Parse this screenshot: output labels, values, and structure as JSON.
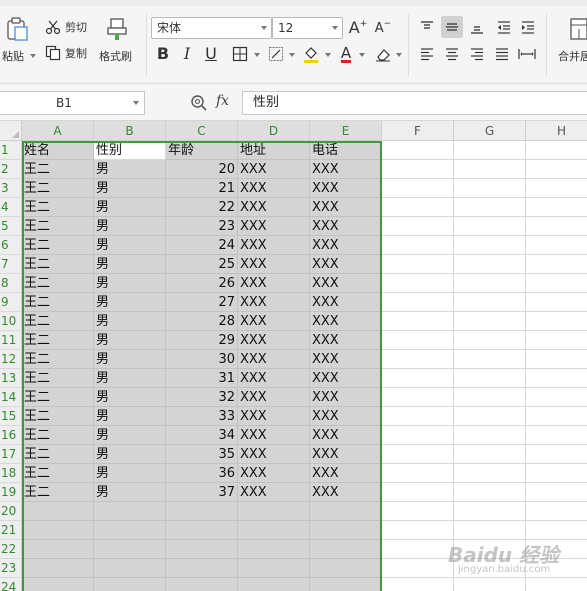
{
  "ribbon": {
    "paste_label": "粘贴",
    "cut_label": "剪切",
    "copy_label": "复制",
    "format_painter_label": "格式刷",
    "font_name": "宋体",
    "font_size": "12",
    "bold": "B",
    "italic": "I",
    "underline": "U",
    "grow_font": "A",
    "shrink_font": "A",
    "font_color": "A",
    "merge_label": "合并居"
  },
  "formula_bar": {
    "name_box": "B1",
    "fx_label": "fx",
    "content": "性别"
  },
  "columns": [
    "A",
    "B",
    "C",
    "D",
    "E",
    "F",
    "G",
    "H"
  ],
  "selected_columns": [
    "A",
    "B",
    "C",
    "D",
    "E"
  ],
  "rows": [
    [
      "姓名",
      "性别",
      "年龄",
      "地址",
      "电话"
    ],
    [
      "王二",
      "男",
      "20",
      "XXX",
      "XXX"
    ],
    [
      "王二",
      "男",
      "21",
      "XXX",
      "XXX"
    ],
    [
      "王二",
      "男",
      "22",
      "XXX",
      "XXX"
    ],
    [
      "王二",
      "男",
      "23",
      "XXX",
      "XXX"
    ],
    [
      "王二",
      "男",
      "24",
      "XXX",
      "XXX"
    ],
    [
      "王二",
      "男",
      "25",
      "XXX",
      "XXX"
    ],
    [
      "王二",
      "男",
      "26",
      "XXX",
      "XXX"
    ],
    [
      "王二",
      "男",
      "27",
      "XXX",
      "XXX"
    ],
    [
      "王二",
      "男",
      "28",
      "XXX",
      "XXX"
    ],
    [
      "王二",
      "男",
      "29",
      "XXX",
      "XXX"
    ],
    [
      "王二",
      "男",
      "30",
      "XXX",
      "XXX"
    ],
    [
      "王二",
      "男",
      "31",
      "XXX",
      "XXX"
    ],
    [
      "王二",
      "男",
      "32",
      "XXX",
      "XXX"
    ],
    [
      "王二",
      "男",
      "33",
      "XXX",
      "XXX"
    ],
    [
      "王二",
      "男",
      "34",
      "XXX",
      "XXX"
    ],
    [
      "王二",
      "男",
      "35",
      "XXX",
      "XXX"
    ],
    [
      "王二",
      "男",
      "36",
      "XXX",
      "XXX"
    ],
    [
      "王二",
      "男",
      "37",
      "XXX",
      "XXX"
    ]
  ],
  "row_numbers": [
    "1",
    "2",
    "3",
    "4",
    "5",
    "6",
    "7",
    "8",
    "9",
    "10",
    "11",
    "12",
    "13",
    "14",
    "15",
    "16",
    "17",
    "18",
    "19",
    "20",
    "21",
    "22",
    "23",
    "24"
  ],
  "active_cell": "B1",
  "watermark": {
    "text": "Baidu 经验",
    "subtext": "jingyan.baidu.com"
  },
  "colors": {
    "selection_border": "#3e9a3e",
    "selection_fill": "#d4d4d4",
    "header_text_selected": "#2e8b2e"
  }
}
